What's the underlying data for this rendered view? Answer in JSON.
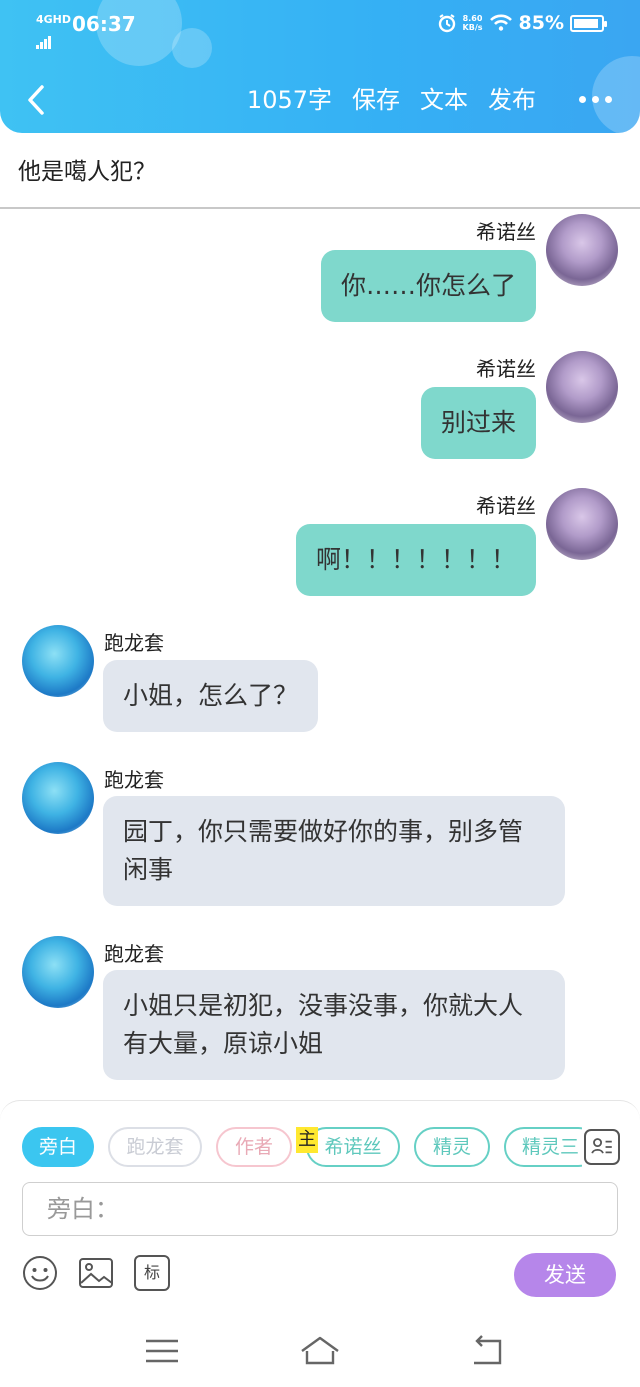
{
  "status_bar": {
    "network": "4GHD",
    "time": "06:37",
    "speed_value": "8.60",
    "speed_unit": "KB/s",
    "battery": "85%",
    "icons": [
      "alarm-icon",
      "wifi-icon",
      "battery-icon"
    ]
  },
  "toolbar": {
    "word_count": "1057字",
    "save_label": "保存",
    "text_label": "文本",
    "publish_label": "发布"
  },
  "title": "他是噶人犯？",
  "messages": [
    {
      "side": "right",
      "name": "希诺丝",
      "text": "你……你怎么了"
    },
    {
      "side": "right",
      "name": "希诺丝",
      "text": "别过来"
    },
    {
      "side": "right",
      "name": "希诺丝",
      "text": "啊！！！！！！！"
    },
    {
      "side": "left",
      "name": "跑龙套",
      "text": "小姐，怎么了？"
    },
    {
      "side": "left",
      "name": "跑龙套",
      "text": "园丁，你只需要做好你的事，别多管闲事"
    },
    {
      "side": "left",
      "name": "跑龙套",
      "text": "小姐只是初犯，没事没事，你就大人有大量，原谅小姐"
    }
  ],
  "composer": {
    "roles": [
      "旁白",
      "跑龙套",
      "作者",
      "希诺丝",
      "精灵",
      "精灵三"
    ],
    "highlight": "主",
    "input_placeholder": "旁白：",
    "mark_label": "标",
    "send_label": "发送"
  },
  "colors": {
    "header": "#35b0f4",
    "bubble_right": "#7fd8cc",
    "bubble_left": "#e1e6ee",
    "send_button": "#b686ea",
    "active_chip": "#3bc6f0"
  }
}
